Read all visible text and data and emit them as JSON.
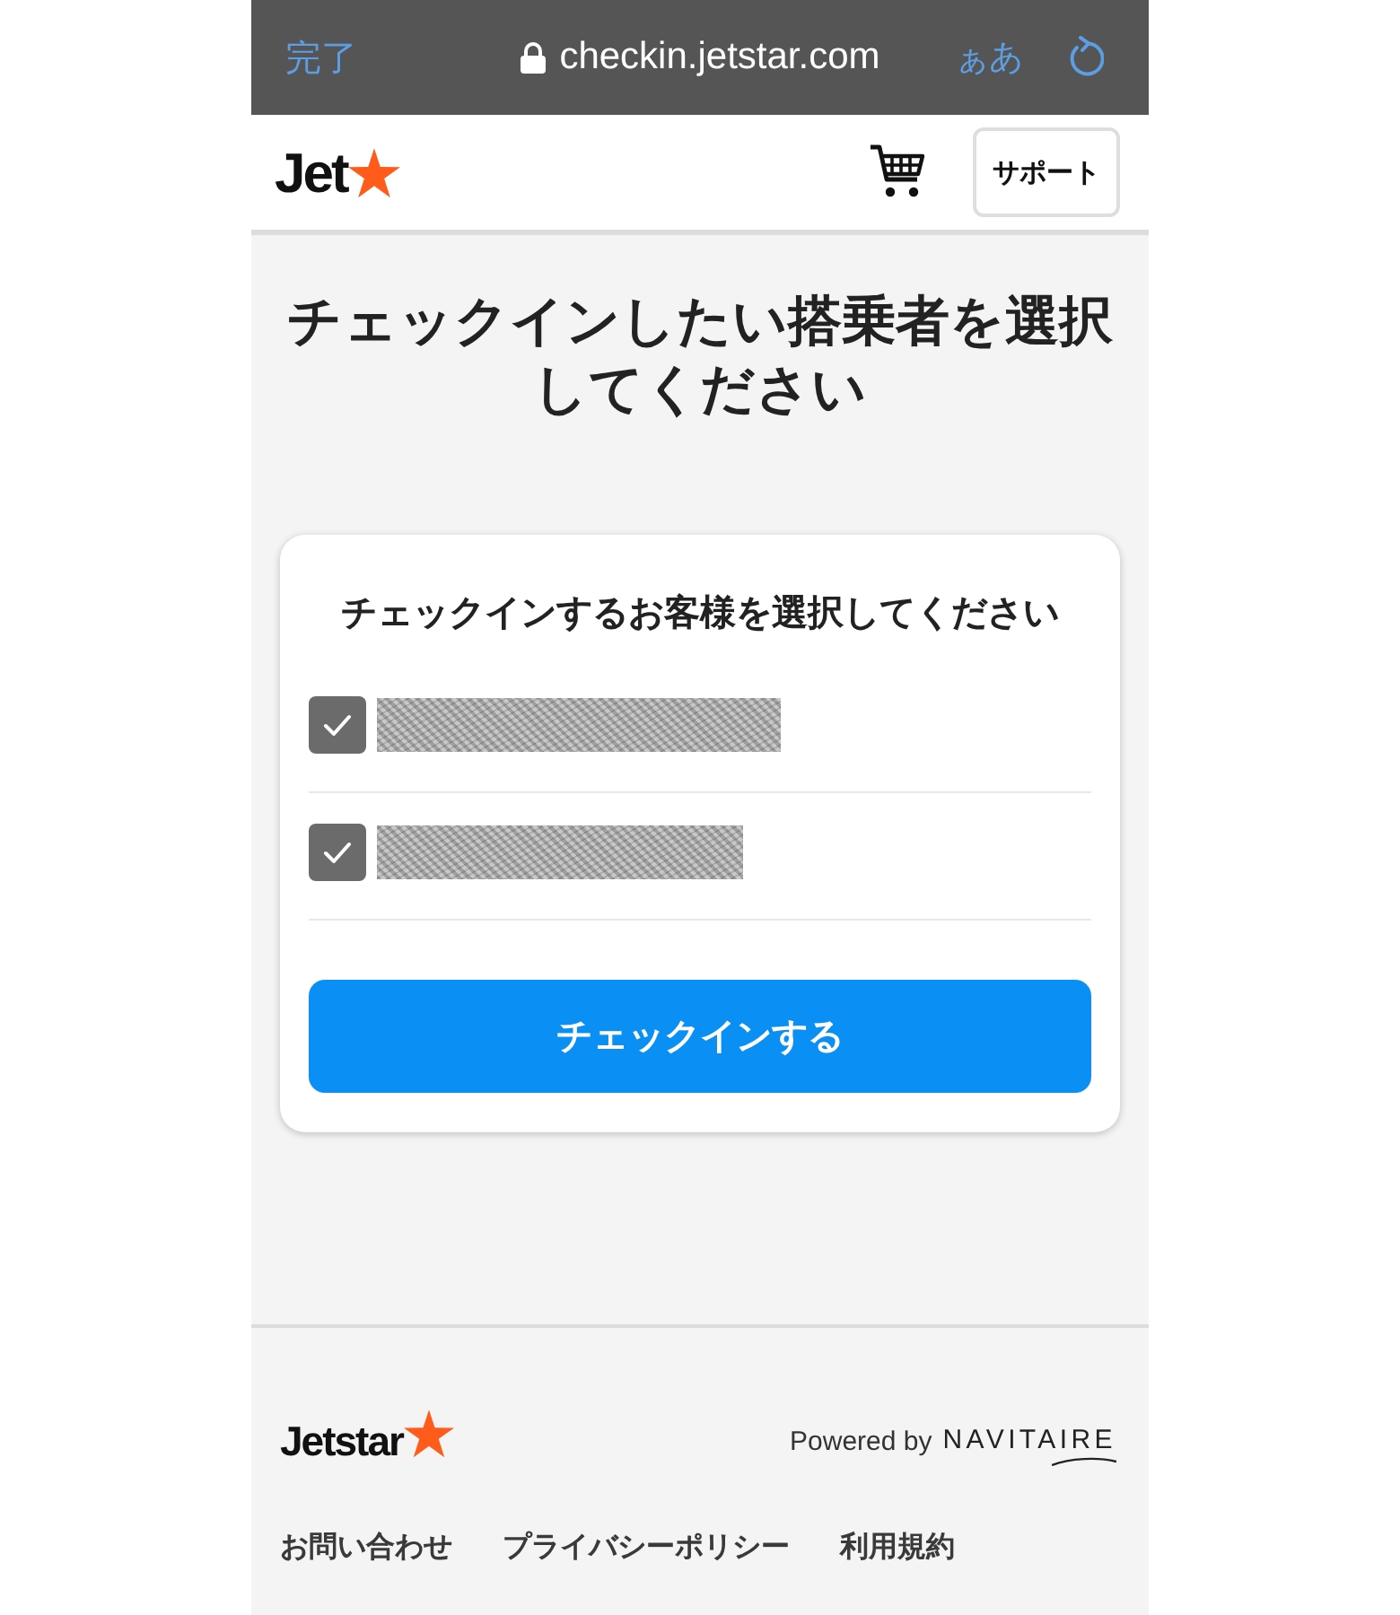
{
  "browser_bar": {
    "done_button": "完了",
    "url": "checkin.jetstar.com",
    "text_size_button": "ぁあ"
  },
  "header": {
    "logo": "Jet",
    "support_button": "サポート"
  },
  "page": {
    "title": "チェックインしたい搭乗者を選択してください"
  },
  "card": {
    "heading": "チェックインするお客様を選択してください",
    "passengers": [
      {
        "checked": true
      },
      {
        "checked": true
      }
    ],
    "submit_button": "チェックインする"
  },
  "footer": {
    "logo": "Jetstar",
    "powered_by": "Powered by",
    "partner_logo": "NAVITAIRE",
    "links": [
      "お問い合わせ",
      "プライバシーポリシー",
      "利用規約"
    ]
  }
}
